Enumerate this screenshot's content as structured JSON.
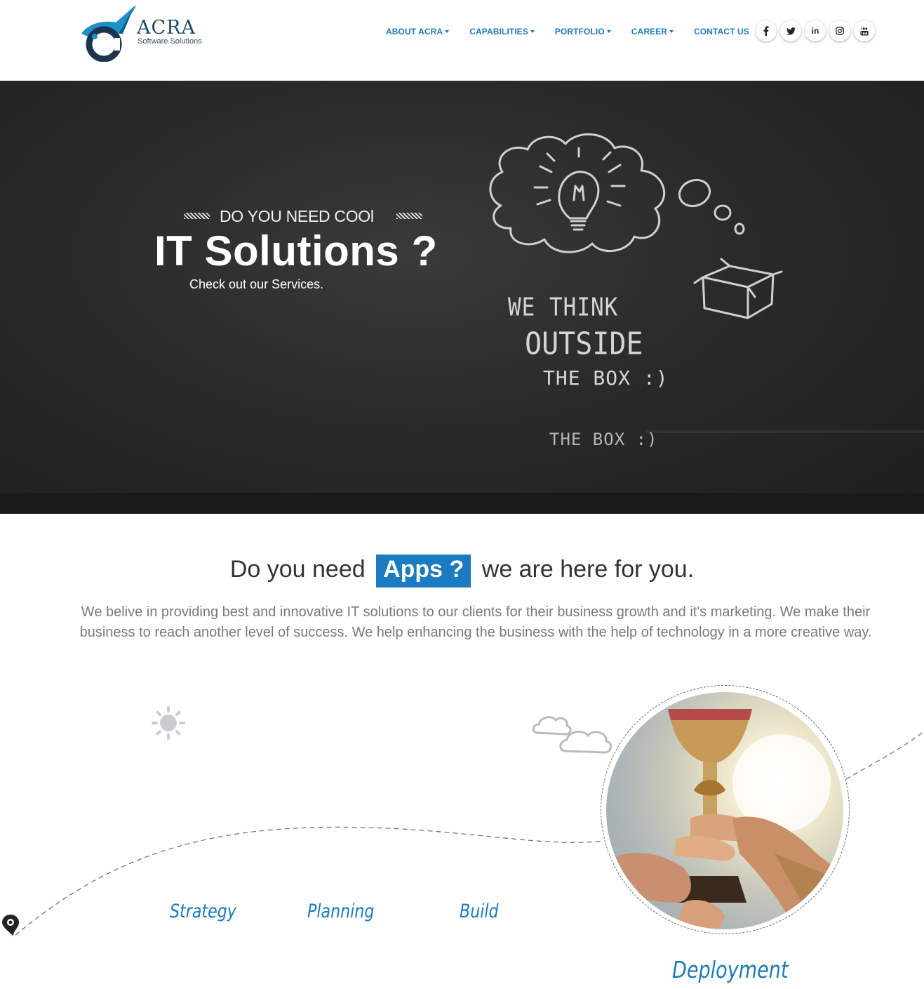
{
  "brand": {
    "name": "ACRA",
    "tagline": "Software Solutions",
    "accent_color": "#1a7bc1",
    "logo_color": "#1a4a6b"
  },
  "nav": {
    "items": [
      {
        "label": "ABOUT ACRA",
        "dropdown": true
      },
      {
        "label": "CAPABILITIES",
        "dropdown": true
      },
      {
        "label": "PORTFOLIO",
        "dropdown": true
      },
      {
        "label": "CAREER",
        "dropdown": true
      },
      {
        "label": "CONTACT US",
        "dropdown": false
      }
    ]
  },
  "social": {
    "icons": [
      "facebook-icon",
      "twitter-icon",
      "linkedin-icon",
      "instagram-icon",
      "youtube-icon"
    ],
    "linkedin_label": "in"
  },
  "hero": {
    "kicker": "DO YOU NEED COOl",
    "title": "IT Solutions ?",
    "subtitle": "Check out our Services.",
    "chalk_line_1": "WE THINK",
    "chalk_line_2": "OUTSIDE",
    "chalk_line_3": "THE BOX :)",
    "chalk_reflection": "THE BOX :)"
  },
  "intro": {
    "heading_pre": "Do you need",
    "heading_highlight": "Apps ?",
    "heading_post": "we are here for you.",
    "body": "We belive in providing best and innovative IT solutions to our clients for their business growth and it's marketing. We make their business to reach another level of success. We help enhancing the business with the help of technology in a more creative way."
  },
  "process": {
    "steps": [
      "Strategy",
      "Planning",
      "Build",
      "Deployment"
    ]
  }
}
